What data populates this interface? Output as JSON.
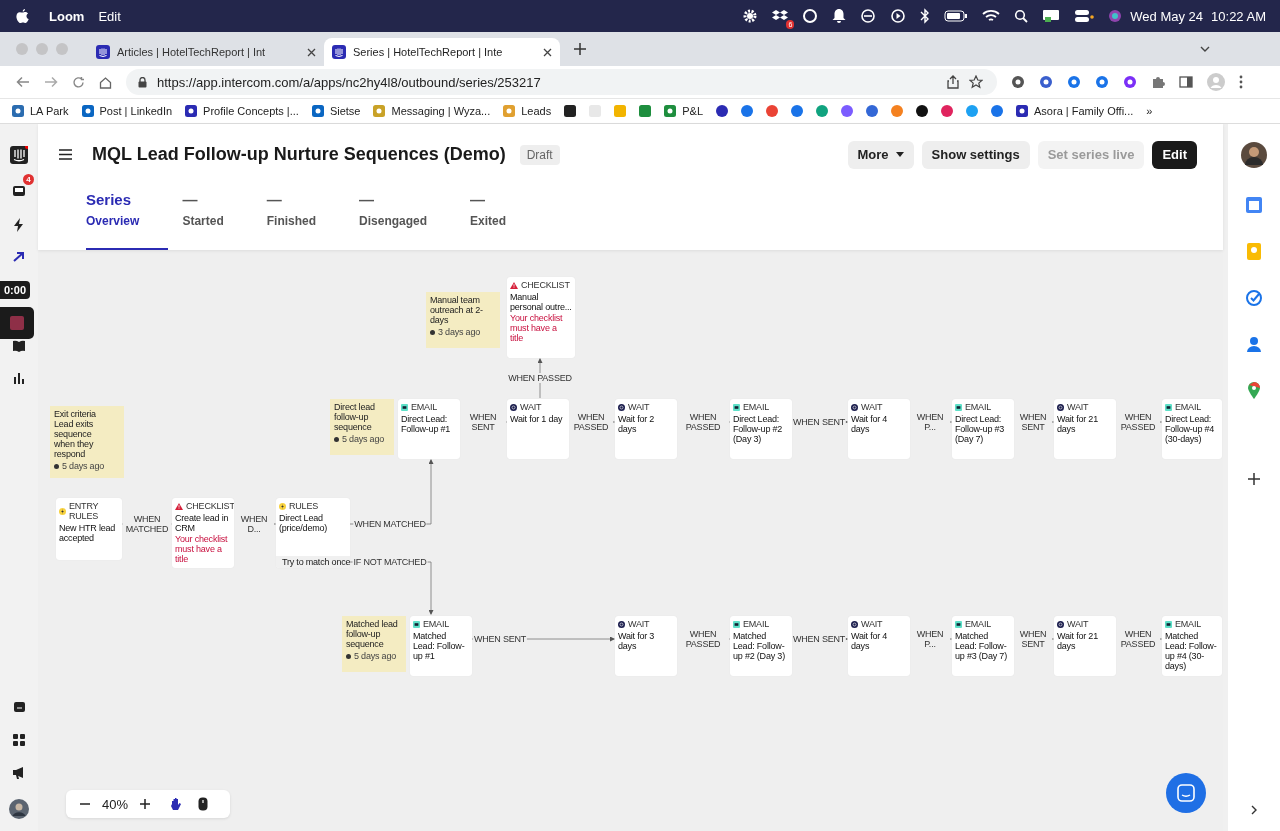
{
  "menubar": {
    "app": "Loom",
    "menus": [
      "Edit"
    ],
    "badge": "6",
    "date": "Wed May 24",
    "time": "10:22 AM"
  },
  "browser": {
    "tabs": [
      {
        "title": "Articles | HotelTechReport | Int",
        "selected": false
      },
      {
        "title": "Series | HotelTechReport | Inte",
        "selected": true
      }
    ],
    "url": "https://app.intercom.com/a/apps/nc2hy4l8/outbound/series/253217",
    "bookmarks": [
      "LA Park",
      "Post | LinkedIn",
      "Profile Concepts |...",
      "Sietse",
      "Messaging | Wyza...",
      "Leads",
      "P&L",
      "Asora | Family Offi..."
    ],
    "more": "»"
  },
  "sidebar": {
    "badge": "4"
  },
  "recorder": {
    "timer": "0:00"
  },
  "header": {
    "title": "MQL Lead Follow-up Nurture Sequences (Demo)",
    "status": "Draft",
    "buttons": [
      {
        "label": "More",
        "kind": "dropdown",
        "disabled": false
      },
      {
        "label": "Show settings",
        "kind": "secondary",
        "disabled": false
      },
      {
        "label": "Set series live",
        "kind": "secondary",
        "disabled": true
      },
      {
        "label": "Edit",
        "kind": "primary",
        "disabled": false
      }
    ]
  },
  "tabs": [
    {
      "value": "Series",
      "label": "Overview",
      "selected": true
    },
    {
      "value": "—",
      "label": "Started",
      "selected": false
    },
    {
      "value": "—",
      "label": "Finished",
      "selected": false
    },
    {
      "value": "—",
      "label": "Disengaged",
      "selected": false
    },
    {
      "value": "—",
      "label": "Exited",
      "selected": false
    }
  ],
  "canvas": {
    "notes": [
      {
        "text": "Exit criteria\nLead exits sequence\nwhen they respond",
        "time": "5 days ago"
      },
      {
        "text": "Direct lead follow-up sequence",
        "time": "5 days ago"
      },
      {
        "text": "Manual team outreach at 2-days",
        "time": "3 days ago"
      },
      {
        "text": "Matched lead follow-up sequence",
        "time": "5 days ago"
      }
    ],
    "nodes": [
      {
        "kind": "entry",
        "type_label": "ENTRY RULES",
        "title": "New HTR lead accepted"
      },
      {
        "kind": "checklist",
        "type_label": "CHECKLIST",
        "title": "Create lead in CRM",
        "warning": "Your checklist must have a title"
      },
      {
        "kind": "rules",
        "type_label": "RULES",
        "title": "Direct Lead (price/demo)",
        "footer": "Try to match once"
      },
      {
        "kind": "email",
        "type_label": "EMAIL",
        "title": "Direct Lead: Follow-up #1"
      },
      {
        "kind": "wait",
        "type_label": "WAIT",
        "title": "Wait for 1 day"
      },
      {
        "kind": "wait",
        "type_label": "WAIT",
        "title": "Wait for 2 days"
      },
      {
        "kind": "email",
        "type_label": "EMAIL",
        "title": "Direct Lead: Follow-up #2 (Day 3)"
      },
      {
        "kind": "wait",
        "type_label": "WAIT",
        "title": "Wait for 4 days"
      },
      {
        "kind": "email",
        "type_label": "EMAIL",
        "title": "Direct Lead: Follow-up #3 (Day 7)"
      },
      {
        "kind": "wait",
        "type_label": "WAIT",
        "title": "Wait for 21 days"
      },
      {
        "kind": "email",
        "type_label": "EMAIL",
        "title": "Direct Lead: Follow-up #4 (30-days)"
      },
      {
        "kind": "checklist",
        "type_label": "CHECKLIST",
        "title": "Manual personal outre...",
        "warning": "Your checklist must have a title"
      },
      {
        "kind": "email",
        "type_label": "EMAIL",
        "title": "Matched Lead: Follow-up #1"
      },
      {
        "kind": "wait",
        "type_label": "WAIT",
        "title": "Wait for 3 days"
      },
      {
        "kind": "email",
        "type_label": "EMAIL",
        "title": "Matched Lead: Follow-up #2 (Day 3)"
      },
      {
        "kind": "wait",
        "type_label": "WAIT",
        "title": "Wait for 4 days"
      },
      {
        "kind": "email",
        "type_label": "EMAIL",
        "title": "Matched Lead: Follow-up #3 (Day 7)"
      },
      {
        "kind": "wait",
        "type_label": "WAIT",
        "title": "Wait for 21 days"
      },
      {
        "kind": "email",
        "type_label": "EMAIL",
        "title": "Matched Lead: Follow-up #4 (30-days)"
      }
    ],
    "edges": [
      {
        "label": "WHEN MATCHED"
      },
      {
        "label": "WHEN D..."
      },
      {
        "label": "WHEN MATCHED"
      },
      {
        "label": "IF NOT MATCHED"
      },
      {
        "label": "WHEN PASSED"
      },
      {
        "label": "WHEN SENT"
      },
      {
        "label": "WHEN PASSED"
      },
      {
        "label": "WHEN PASSED"
      },
      {
        "label": "WHEN SENT"
      },
      {
        "label": "WHEN P..."
      },
      {
        "label": "WHEN SENT"
      },
      {
        "label": "WHEN PASSED"
      },
      {
        "label": "WHEN SENT"
      },
      {
        "label": "WHEN PASSED"
      },
      {
        "label": "WHEN SENT"
      },
      {
        "label": "WHEN P..."
      },
      {
        "label": "WHEN SENT"
      },
      {
        "label": "WHEN PASSED"
      }
    ],
    "zoom": "40%"
  }
}
